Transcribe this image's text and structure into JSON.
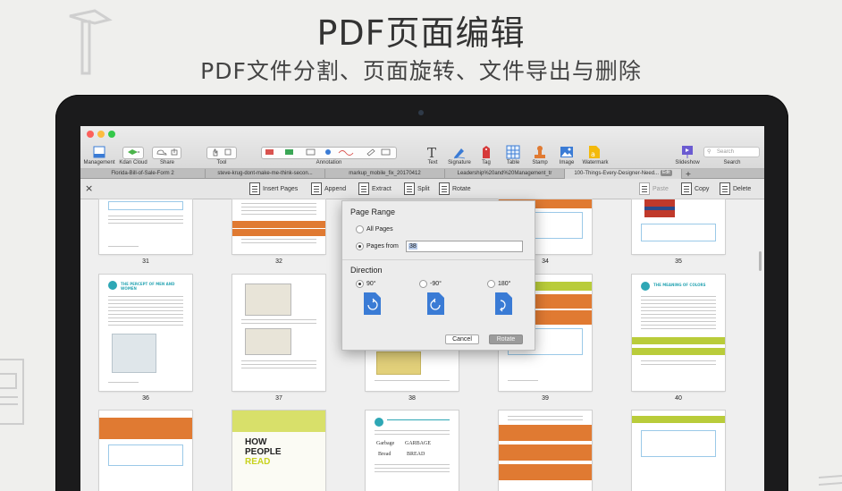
{
  "headline": "PDF页面编辑",
  "subline": "PDF文件分割、页面旋转、文件导出与删除",
  "toolbar": {
    "groups": {
      "management": "Management",
      "kdan_cloud": "Kdan Cloud",
      "share": "Share",
      "tool": "Tool",
      "annotation": "Annotation",
      "text": "Text",
      "signature": "Signature",
      "tag": "Tag",
      "table": "Table",
      "stamp": "Stamp",
      "image": "Image",
      "watermark": "Watermark",
      "slideshow": "Slideshow",
      "search": "Search"
    },
    "search_placeholder": "Search"
  },
  "tabs": [
    {
      "label": "Florida-Bill-of-Sale-Form 2"
    },
    {
      "label": "steve-krug-dont-make-me-think-secon..."
    },
    {
      "label": "markup_mobile_fix_20170412"
    },
    {
      "label": "Leadership%20and%20Management_tr"
    },
    {
      "label": "100-Things-Every-Designer-Need..."
    }
  ],
  "active_tab_badge": "Edit",
  "tab_add": "+",
  "pagebar": {
    "close": "×",
    "insert": "Insert Pages",
    "append": "Append",
    "extract": "Extract",
    "split": "Split",
    "rotate": "Rotate",
    "paste": "Paste",
    "copy": "Copy",
    "delete": "Delete"
  },
  "pages": {
    "row1": [
      "31",
      "32",
      "33",
      "34",
      "35"
    ],
    "row2": [
      "36",
      "37",
      "38",
      "39",
      "40"
    ]
  },
  "dialog": {
    "page_range_title": "Page Range",
    "all_pages": "All Pages",
    "pages_from": "Pages from",
    "pages_from_value": "38",
    "direction_title": "Direction",
    "dir_90": "90°",
    "dir_neg90": "-90°",
    "dir_180": "180°",
    "cancel": "Cancel",
    "rotate": "Rotate"
  },
  "thumb_text": {
    "p36_heading": "THE PERCEPT OF MEN AND WOMEN",
    "p40_heading": "THE MEANING OF COLORS",
    "p43_how": "HOW",
    "p43_people": "PEOPLE",
    "p43_read": "READ",
    "p44_garbage": "Garbage",
    "p44_garbage_caps": "GARBAGE",
    "p44_bread": "Bread",
    "p44_bread_caps": "BREAD"
  },
  "colors": {
    "accent_orange": "#e07a32",
    "accent_green": "#b9cc3a",
    "accent_blue": "#3a7bd5",
    "teal": "#2ea7b5",
    "primary_button": "#9b9b9b"
  }
}
